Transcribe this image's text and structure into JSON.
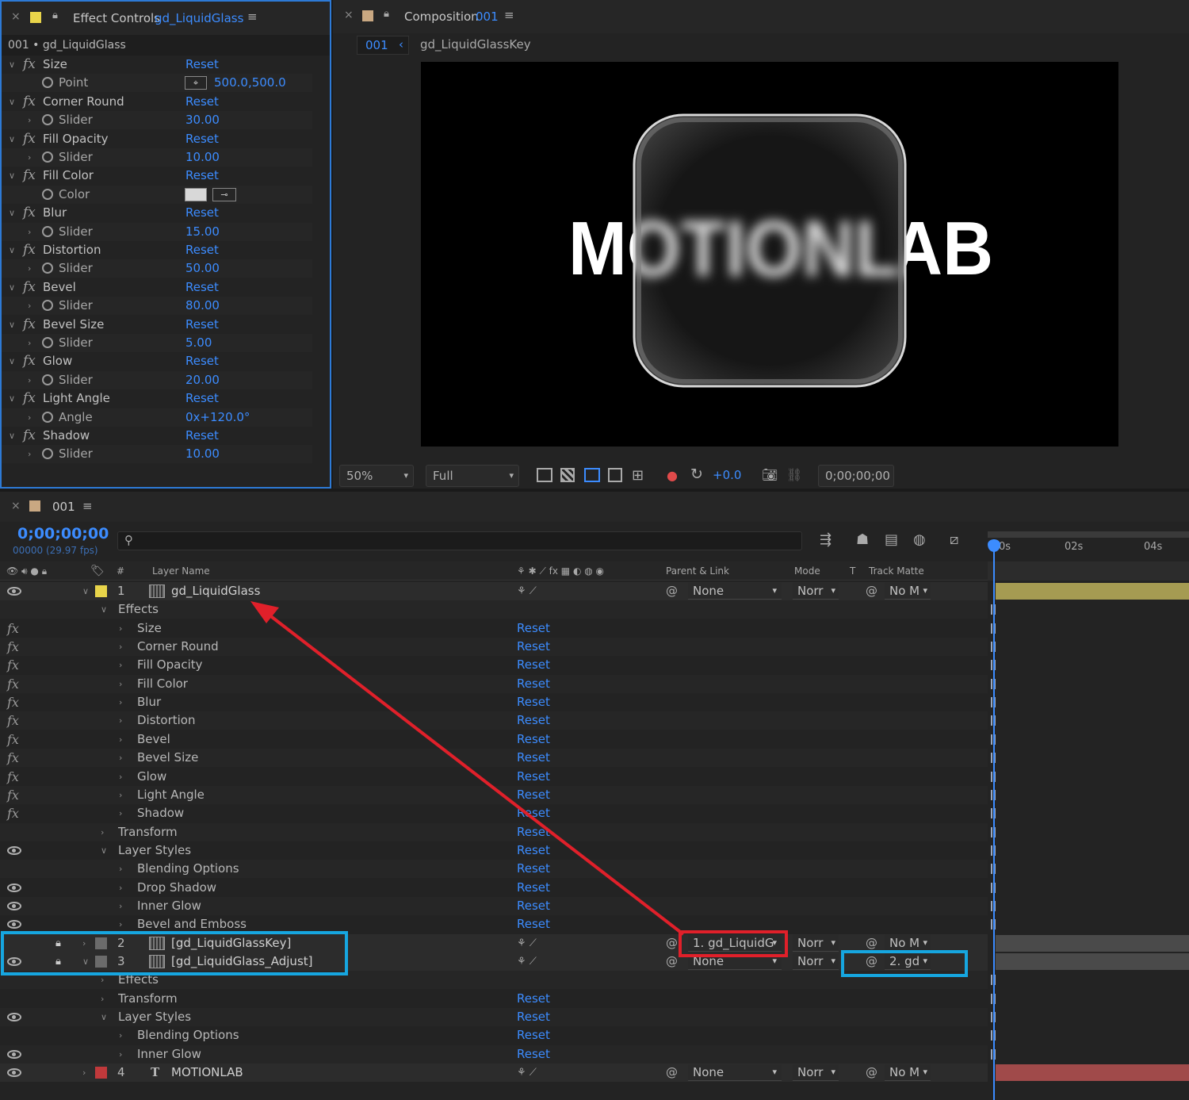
{
  "effect_controls": {
    "tab_title": "Effect Controls",
    "tab_layer": "gd_LiquidGlass",
    "subtitle": "001 • gd_LiquidGlass",
    "effects": [
      {
        "name": "Size",
        "reset": "Reset",
        "param": "Point",
        "value": "500.0,500.0",
        "type": "point"
      },
      {
        "name": "Corner Round",
        "reset": "Reset",
        "param": "Slider",
        "value": "30.00"
      },
      {
        "name": "Fill Opacity",
        "reset": "Reset",
        "param": "Slider",
        "value": "10.00"
      },
      {
        "name": "Fill Color",
        "reset": "Reset",
        "param": "Color",
        "value": "",
        "type": "color"
      },
      {
        "name": "Blur",
        "reset": "Reset",
        "param": "Slider",
        "value": "15.00"
      },
      {
        "name": "Distortion",
        "reset": "Reset",
        "param": "Slider",
        "value": "50.00"
      },
      {
        "name": "Bevel",
        "reset": "Reset",
        "param": "Slider",
        "value": "80.00"
      },
      {
        "name": "Bevel Size",
        "reset": "Reset",
        "param": "Slider",
        "value": "5.00"
      },
      {
        "name": "Glow",
        "reset": "Reset",
        "param": "Slider",
        "value": "20.00"
      },
      {
        "name": "Light Angle",
        "reset": "Reset",
        "param": "Angle",
        "value": "0x+120.0°"
      },
      {
        "name": "Shadow",
        "reset": "Reset",
        "param": "Slider",
        "value": "10.00"
      }
    ]
  },
  "composition": {
    "tab_label": "Composition",
    "tab_name": "001",
    "breadcrumb_active": "001",
    "breadcrumb_next": "gd_LiquidGlassKey",
    "viewer_text": "MOTIONLAB",
    "zoom": "50%",
    "resolution": "Full",
    "exposure": "+0.0",
    "timecode": "0;00;00;00"
  },
  "timeline": {
    "tab_name": "001",
    "timecode": "0;00;00;00",
    "frame_info": "00000 (29.97 fps)",
    "search_placeholder": "",
    "columns": {
      "layer_name": "Layer Name",
      "parent": "Parent & Link",
      "mode": "Mode",
      "t": "T",
      "track_matte": "Track Matte",
      "num": "#"
    },
    "ruler": [
      "0s",
      "02s",
      "04s"
    ],
    "rows": [
      {
        "kind": "layer",
        "num": "1",
        "name": "gd_LiquidGlass",
        "label_color": "#e8d44a",
        "parent": "None",
        "mode": "Norr",
        "matte": "No M",
        "eye": true,
        "open": true
      },
      {
        "kind": "group",
        "name": "Effects",
        "indent": 1
      },
      {
        "kind": "fx",
        "name": "Size",
        "reset": "Reset"
      },
      {
        "kind": "fx",
        "name": "Corner Round",
        "reset": "Reset"
      },
      {
        "kind": "fx",
        "name": "Fill Opacity",
        "reset": "Reset"
      },
      {
        "kind": "fx",
        "name": "Fill Color",
        "reset": "Reset"
      },
      {
        "kind": "fx",
        "name": "Blur",
        "reset": "Reset"
      },
      {
        "kind": "fx",
        "name": "Distortion",
        "reset": "Reset"
      },
      {
        "kind": "fx",
        "name": "Bevel",
        "reset": "Reset"
      },
      {
        "kind": "fx",
        "name": "Bevel Size",
        "reset": "Reset"
      },
      {
        "kind": "fx",
        "name": "Glow",
        "reset": "Reset"
      },
      {
        "kind": "fx",
        "name": "Light Angle",
        "reset": "Reset"
      },
      {
        "kind": "fx",
        "name": "Shadow",
        "reset": "Reset"
      },
      {
        "kind": "group",
        "name": "Transform",
        "reset": "Reset",
        "closed": true
      },
      {
        "kind": "group",
        "name": "Layer Styles",
        "reset": "Reset",
        "eye": true
      },
      {
        "kind": "sub",
        "name": "Blending Options",
        "reset": "Reset"
      },
      {
        "kind": "sub",
        "name": "Drop Shadow",
        "reset": "Reset",
        "eye": true
      },
      {
        "kind": "sub",
        "name": "Inner Glow",
        "reset": "Reset",
        "eye": true
      },
      {
        "kind": "sub",
        "name": "Bevel and Emboss",
        "reset": "Reset",
        "eye": true
      },
      {
        "kind": "layer",
        "num": "2",
        "name": "[gd_LiquidGlassKey]",
        "label_color": "#6b6b6b",
        "parent": "1. gd_LiquidG",
        "mode": "Norr",
        "matte": "No M",
        "eye": false,
        "open": false,
        "locked": true
      },
      {
        "kind": "layer",
        "num": "3",
        "name": "[gd_LiquidGlass_Adjust]",
        "label_color": "#6b6b6b",
        "parent": "None",
        "mode": "Norr",
        "matte": "2. gd",
        "eye": true,
        "open": true,
        "locked": true
      },
      {
        "kind": "group",
        "name": "Effects",
        "closed": true
      },
      {
        "kind": "group",
        "name": "Transform",
        "reset": "Reset",
        "closed": true
      },
      {
        "kind": "group",
        "name": "Layer Styles",
        "reset": "Reset",
        "eye": true
      },
      {
        "kind": "sub",
        "name": "Blending Options",
        "reset": "Reset"
      },
      {
        "kind": "sub",
        "name": "Inner Glow",
        "reset": "Reset",
        "eye": true
      },
      {
        "kind": "layer",
        "num": "4",
        "name": "MOTIONLAB",
        "label_color": "#c0393b",
        "parent": "None",
        "mode": "Norr",
        "matte": "No M",
        "eye": true,
        "open": false,
        "text_layer": true
      }
    ]
  },
  "colors": {
    "accent_blue": "#2d7ad6",
    "link_blue": "#3c8cff",
    "annotation_red": "#e0202a",
    "annotation_cyan": "#16a6e0"
  }
}
